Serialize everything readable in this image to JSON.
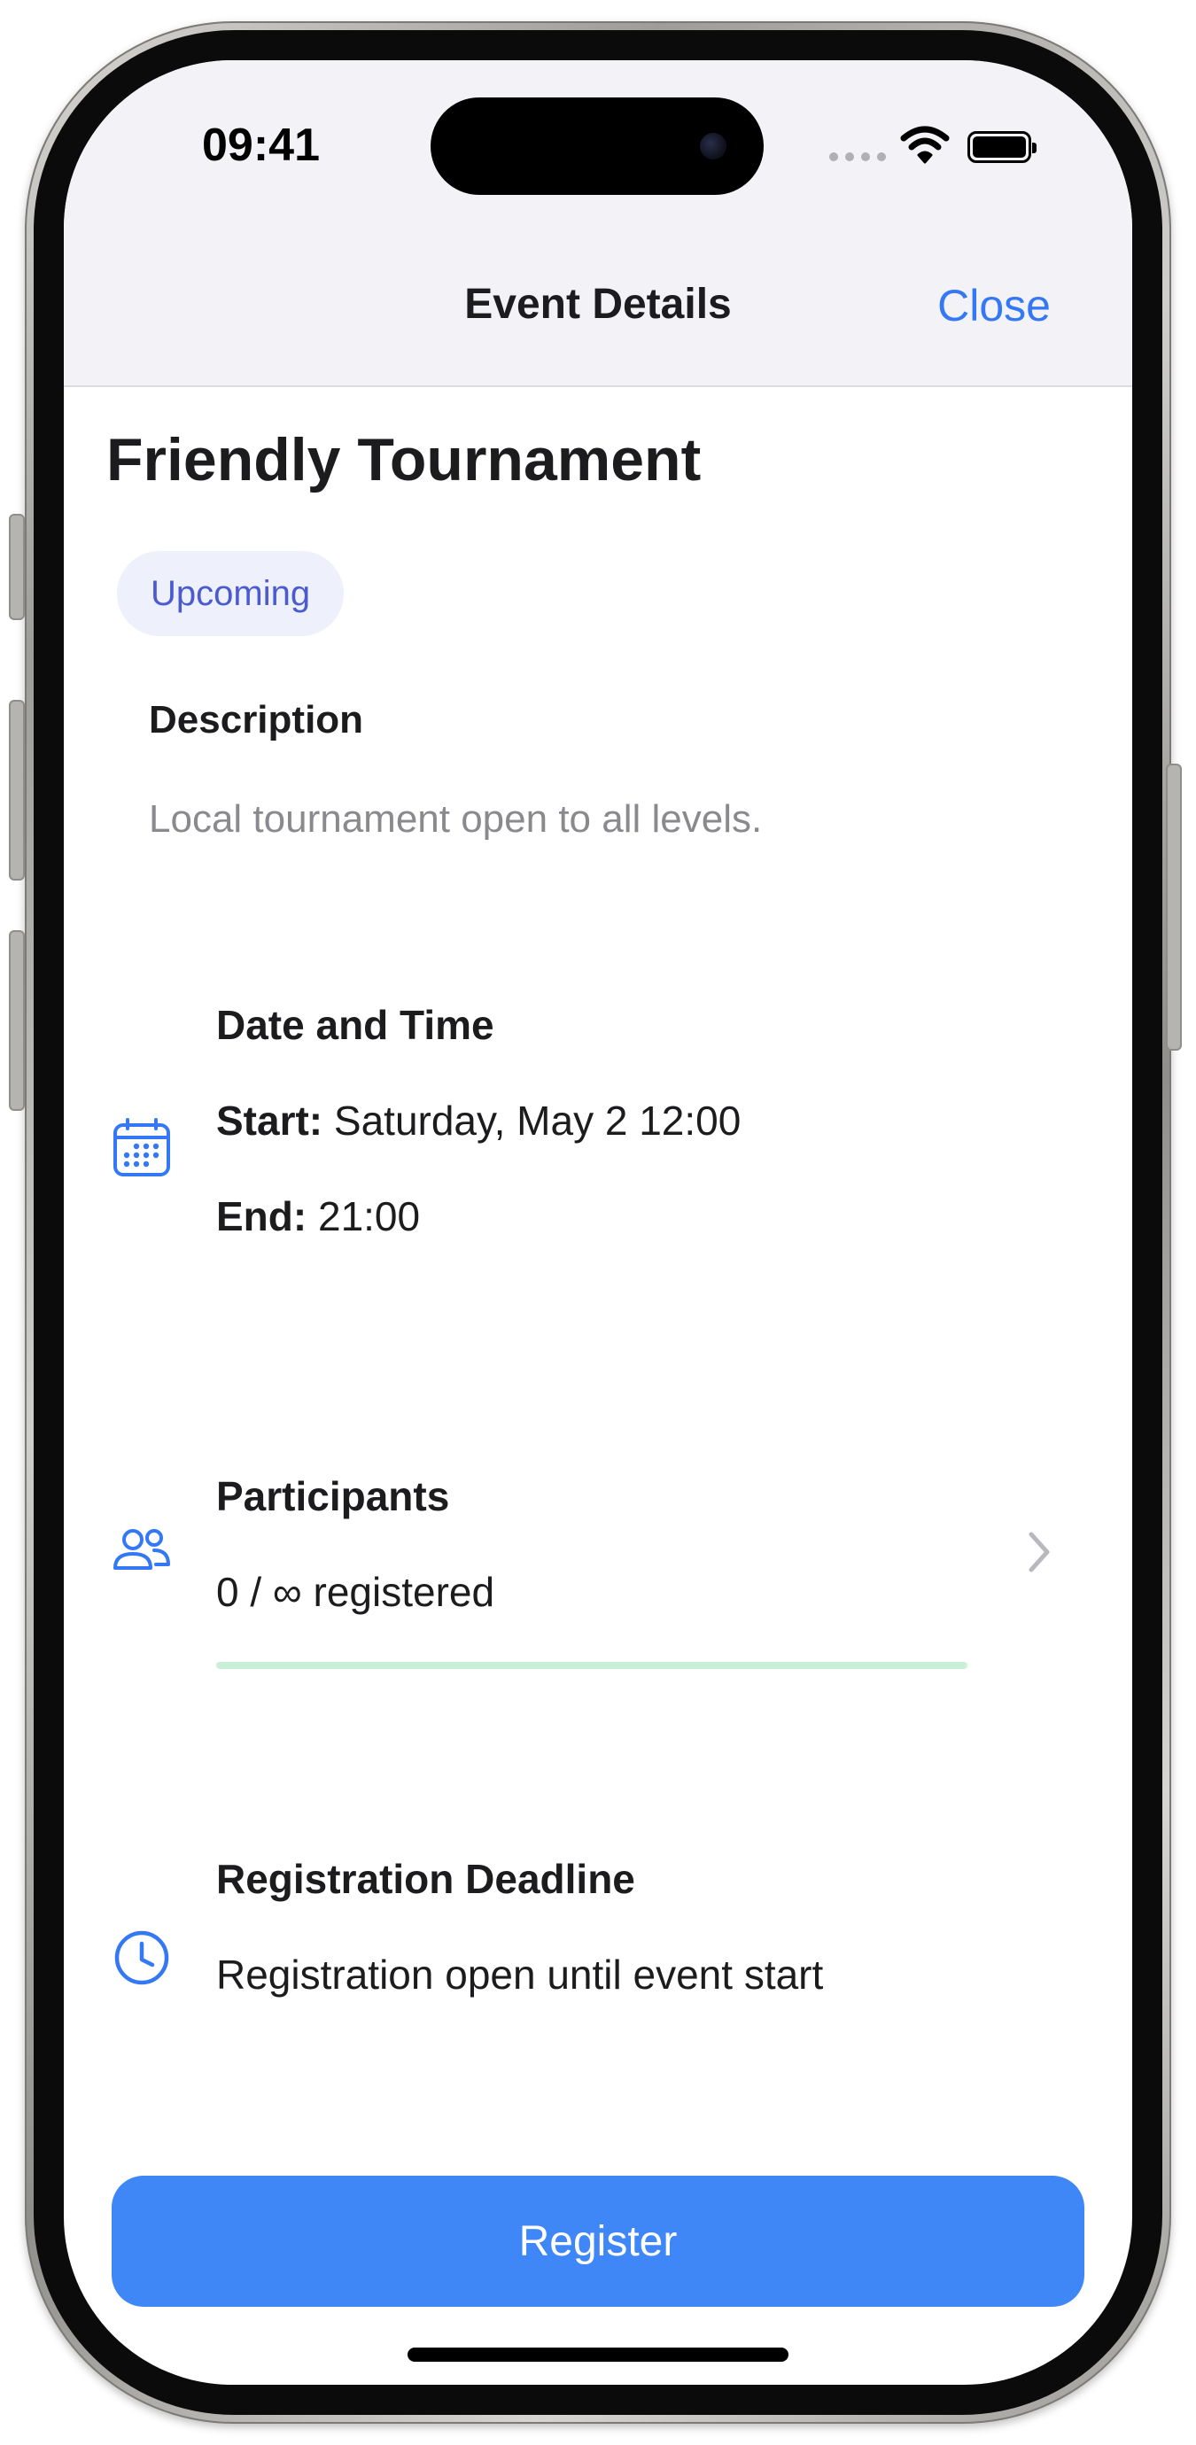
{
  "status_bar": {
    "time": "09:41"
  },
  "nav": {
    "title": "Event Details",
    "close_label": "Close"
  },
  "event": {
    "title": "Friendly Tournament",
    "status": "Upcoming",
    "description_label": "Description",
    "description": "Local tournament open to all levels."
  },
  "date_time": {
    "title": "Date and Time",
    "start_label": "Start:",
    "start_value": "Saturday, May 2 12:00",
    "end_label": "End:",
    "end_value": "21:00",
    "icon": "calendar-icon"
  },
  "participants": {
    "title": "Participants",
    "count_text": "0 / ∞ registered",
    "progress_fraction": 0,
    "icon": "people-icon"
  },
  "deadline": {
    "title": "Registration Deadline",
    "text": "Registration open until event start",
    "icon": "clock-icon"
  },
  "actions": {
    "register_label": "Register"
  },
  "colors": {
    "accent": "#3478f6",
    "button": "#3f87f7",
    "badge_bg": "#eef0fb",
    "badge_text": "#4a5bd0",
    "progress": "#c9f0d6"
  }
}
